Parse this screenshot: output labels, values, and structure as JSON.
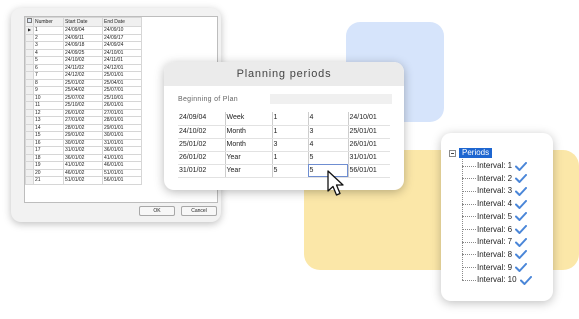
{
  "grid_dialog": {
    "columns": [
      "Number",
      "Start Date",
      "End Date"
    ],
    "rows": [
      [
        "1",
        "24/09/04",
        "24/09/10"
      ],
      [
        "2",
        "24/09/11",
        "24/09/17"
      ],
      [
        "3",
        "24/09/18",
        "24/09/24"
      ],
      [
        "4",
        "24/09/25",
        "24/10/01"
      ],
      [
        "5",
        "24/10/02",
        "24/11/01"
      ],
      [
        "6",
        "24/11/02",
        "24/12/01"
      ],
      [
        "7",
        "24/12/02",
        "25/01/01"
      ],
      [
        "8",
        "25/01/02",
        "25/04/01"
      ],
      [
        "9",
        "25/04/02",
        "25/07/01"
      ],
      [
        "10",
        "25/07/02",
        "25/10/01"
      ],
      [
        "11",
        "25/10/02",
        "26/01/01"
      ],
      [
        "12",
        "26/01/02",
        "27/01/01"
      ],
      [
        "13",
        "27/01/02",
        "28/01/01"
      ],
      [
        "14",
        "28/01/02",
        "29/01/01"
      ],
      [
        "15",
        "29/01/02",
        "30/01/01"
      ],
      [
        "16",
        "30/01/02",
        "31/01/01"
      ],
      [
        "17",
        "31/01/02",
        "36/01/01"
      ],
      [
        "18",
        "36/01/02",
        "41/01/01"
      ],
      [
        "19",
        "41/01/02",
        "46/01/01"
      ],
      [
        "20",
        "46/01/02",
        "51/01/01"
      ],
      [
        "21",
        "51/01/02",
        "56/01/01"
      ]
    ],
    "current_row_marker": "▶",
    "ok_label": "OK",
    "cancel_label": "Cancel"
  },
  "planning": {
    "title": "Planning periods",
    "beginning_label": "Beginning of Plan",
    "beginning_value": "",
    "rows": [
      [
        "24/09/04",
        "Week",
        "1",
        "4",
        "24/10/01"
      ],
      [
        "24/10/02",
        "Month",
        "1",
        "3",
        "25/01/01"
      ],
      [
        "25/01/02",
        "Month",
        "3",
        "4",
        "26/01/01"
      ],
      [
        "26/01/02",
        "Year",
        "1",
        "5",
        "31/01/01"
      ],
      [
        "31/01/02",
        "Year",
        "5",
        "5",
        "56/01/01"
      ]
    ]
  },
  "tree": {
    "root_label": "Periods",
    "items": [
      "Interval: 1",
      "Interval: 2",
      "Interval: 3",
      "Interval: 4",
      "Interval: 5",
      "Interval: 6",
      "Interval: 7",
      "Interval: 8",
      "Interval: 9",
      "Interval: 10"
    ],
    "check_icon": "check-icon",
    "check_color": "#4a86d8",
    "root_highlight_color": "#1e66d0"
  },
  "colors": {
    "deco_blue": "#d6e4fb",
    "deco_yellow": "#fbe7a8"
  }
}
